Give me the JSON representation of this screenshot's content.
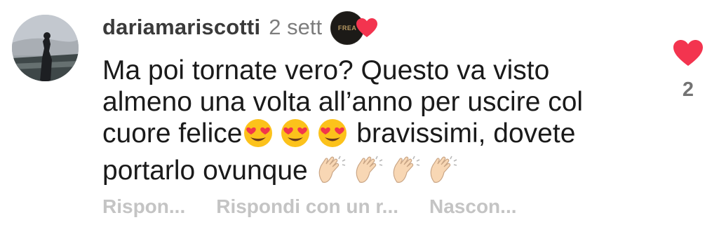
{
  "comment": {
    "username": "dariamariscotti",
    "time": "2 sett",
    "author_badge_text": "FREA",
    "text_lines": [
      "Ma poi tornate vero? Questo va visto",
      "almeno una volta all’anno per uscire col",
      "cuore felice",
      " bravissimi, dovete",
      "portarlo ovunque "
    ],
    "emojis": {
      "heart_eyes": "smiling-face-with-heart-eyes",
      "clap": "clapping-hands-light-skin"
    },
    "like_count": "2"
  },
  "actions": {
    "reply": "Rispon...",
    "reply_with": "Rispondi con un r...",
    "hide": "Nascon..."
  },
  "colors": {
    "heart": "#f3344f",
    "muted": "#c4c4c4"
  }
}
